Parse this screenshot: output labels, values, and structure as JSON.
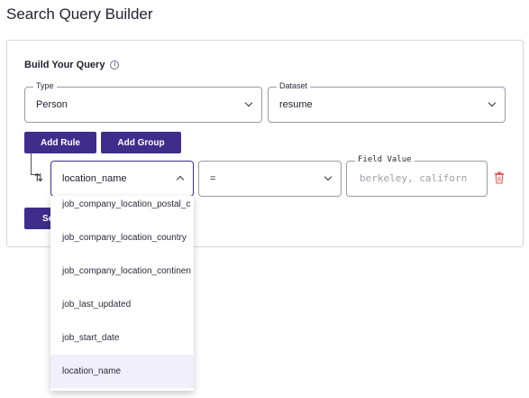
{
  "page": {
    "title": "Search Query Builder"
  },
  "builder": {
    "heading": "Build Your Query",
    "info_icon": "info-icon",
    "type_select": {
      "legend": "Type",
      "value": "Person"
    },
    "dataset_select": {
      "legend": "Dataset",
      "value": "resume"
    },
    "add_rule_label": "Add Rule",
    "add_group_label": "Add Group",
    "search_button_label": "Se",
    "rule": {
      "field_value": "location_name",
      "operator_value": "=",
      "field_value_legend": "Field Value",
      "field_value_placeholder": "berkeley, californ"
    },
    "dropdown": {
      "options": [
        "job_company_location_postal_c",
        "job_company_location_country",
        "job_company_location_continen",
        "job_last_updated",
        "job_start_date",
        "location_name"
      ],
      "selected": "location_name"
    }
  },
  "colors": {
    "accent": "#3f2d8c",
    "danger": "#e05a5a",
    "selected_bg": "#f1effb"
  }
}
